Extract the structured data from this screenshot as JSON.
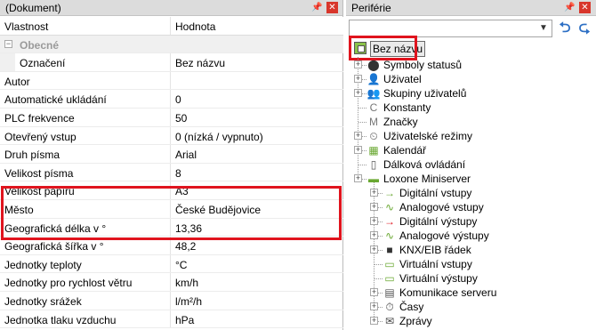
{
  "left_panel": {
    "title": "(Dokument)",
    "pin_icon": "pin-icon",
    "close_icon": "close-icon",
    "columns": {
      "property": "Vlastnost",
      "value": "Hodnota"
    },
    "group": {
      "label": "Obecné",
      "toggle": "−"
    },
    "rows": [
      {
        "name": "Označení",
        "value": "Bez názvu"
      },
      {
        "name": "Autor",
        "value": ""
      },
      {
        "name": "Automatické ukládání",
        "value": "0"
      },
      {
        "name": "PLC frekvence",
        "value": "50"
      },
      {
        "name": "Otevřený vstup",
        "value": "0 (nízká / vypnuto)"
      },
      {
        "name": "Druh písma",
        "value": "Arial"
      },
      {
        "name": "Velikost písma",
        "value": "8"
      },
      {
        "name": "Velikost papíru",
        "value": "A3"
      },
      {
        "name": "Město",
        "value": "České Budějovice"
      },
      {
        "name": "Geografická délka v °",
        "value": "13,36"
      },
      {
        "name": "Geografická šířka v °",
        "value": "48,2"
      },
      {
        "name": "Jednotky teploty",
        "value": "°C"
      },
      {
        "name": "Jednotky pro rychlost větru",
        "value": "km/h"
      },
      {
        "name": "Jednotky srážek",
        "value": "l/m²/h"
      },
      {
        "name": "Jednotka tlaku vzduchu",
        "value": "hPa"
      }
    ]
  },
  "right_panel": {
    "title": "Periférie",
    "search_value": "",
    "back_icon": "arrow-left-icon",
    "forward_icon": "arrow-right-icon",
    "root": {
      "label": "Bez názvu",
      "icon": "project-icon"
    },
    "items": [
      {
        "label": "Symboly statusů",
        "icon": "status-symbols-icon",
        "glyph": "⬤"
      },
      {
        "label": "Uživatel",
        "icon": "user-icon",
        "glyph": "👤"
      },
      {
        "label": "Skupiny uživatelů",
        "icon": "user-groups-icon",
        "glyph": "👥"
      },
      {
        "label": "Konstanty",
        "icon": "constants-icon",
        "glyph": "C"
      },
      {
        "label": "Značky",
        "icon": "markers-icon",
        "glyph": "M"
      },
      {
        "label": "Uživatelské režimy",
        "icon": "user-modes-icon",
        "glyph": "⏲"
      },
      {
        "label": "Kalendář",
        "icon": "calendar-icon",
        "glyph": "▦"
      },
      {
        "label": "Dálková ovládání",
        "icon": "remote-control-icon",
        "glyph": "▯"
      },
      {
        "label": "Loxone Miniserver",
        "icon": "miniserver-icon",
        "glyph": "▬"
      },
      {
        "label": "Digitální vstupy",
        "icon": "digital-inputs-icon",
        "glyph": "→"
      },
      {
        "label": "Analogové vstupy",
        "icon": "analog-inputs-icon",
        "glyph": "∿"
      },
      {
        "label": "Digitální výstupy",
        "icon": "digital-outputs-icon",
        "glyph": "→"
      },
      {
        "label": "Analogové výstupy",
        "icon": "analog-outputs-icon",
        "glyph": "∿"
      },
      {
        "label": "KNX/EIB řádek",
        "icon": "knx-icon",
        "glyph": "■"
      },
      {
        "label": "Virtuální vstupy",
        "icon": "virtual-inputs-icon",
        "glyph": "▭"
      },
      {
        "label": "Virtuální výstupy",
        "icon": "virtual-outputs-icon",
        "glyph": "▭"
      },
      {
        "label": "Komunikace serveru",
        "icon": "server-communication-icon",
        "glyph": "▤"
      },
      {
        "label": "Časy",
        "icon": "times-icon",
        "glyph": "⏱"
      },
      {
        "label": "Zprávy",
        "icon": "messages-icon",
        "glyph": "✉"
      }
    ]
  },
  "colors": {
    "highlight": "#e0141e",
    "header_bg": "#dcdcdc",
    "close_red": "#d8362b",
    "nav_blue": "#2d6fc4"
  }
}
